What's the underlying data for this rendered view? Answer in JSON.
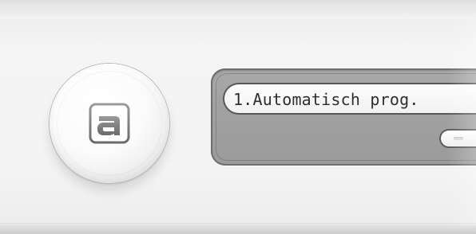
{
  "display": {
    "menu_item": "1.Automatisch prog."
  },
  "controls": {
    "round_button_icon": "brand-logo-icon",
    "minus_button_icon": "minus-icon"
  },
  "colors": {
    "panel_bg": "#f4f4f4",
    "display_bg": "#a6a6a6",
    "display_border": "#585858",
    "menu_text": "#2e2e2e"
  }
}
